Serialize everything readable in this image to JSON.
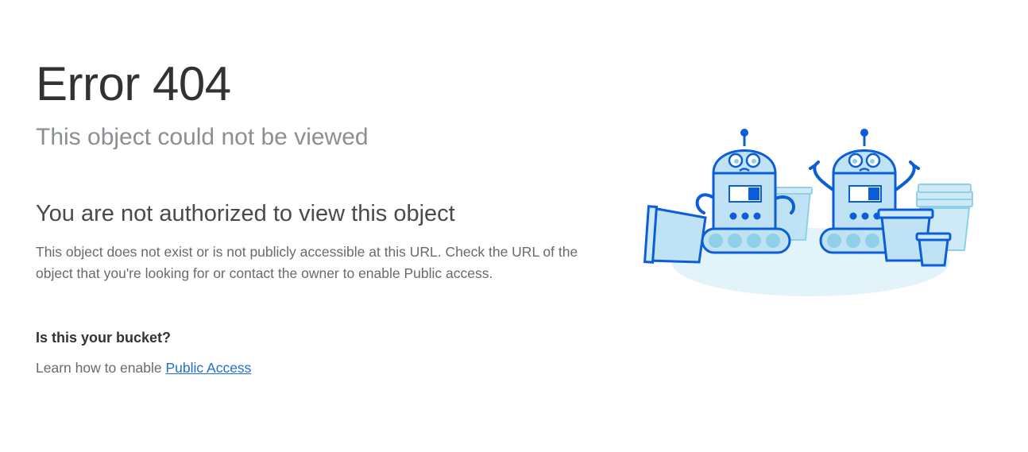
{
  "error": {
    "title": "Error 404",
    "subtitle": "This object could not be viewed"
  },
  "message": {
    "heading": "You are not authorized to view this object",
    "description": "This object does not exist or is not publicly accessible at this URL. Check the URL of the object that you're looking for or contact the owner to enable Public access."
  },
  "help": {
    "question": "Is this your bucket?",
    "prefix": "Learn how to enable ",
    "link_label": "Public Access"
  },
  "illustration": {
    "icon": "confused-robots-illustration"
  },
  "colors": {
    "title": "#323232",
    "subtitle": "#8a8f94",
    "link": "#1f6fd1",
    "robot_outline": "#0b5ed7",
    "robot_fill": "#bfe3f4",
    "shadow": "#e2f3fa"
  }
}
